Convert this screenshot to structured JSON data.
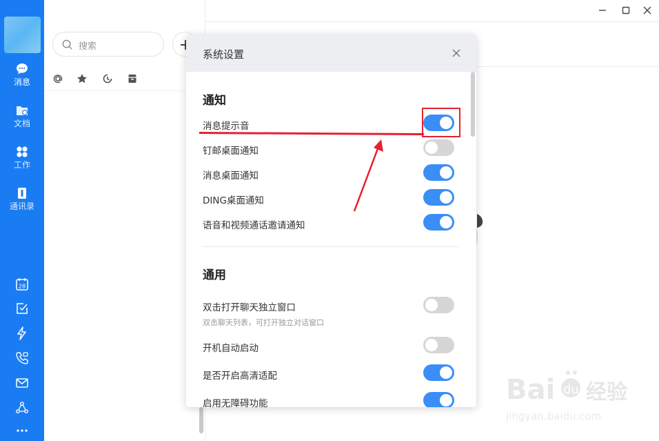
{
  "sidebar": {
    "nav": [
      {
        "label": "消息",
        "icon": "chat-bubble-icon",
        "active": true
      },
      {
        "label": "文档",
        "icon": "folder-icon",
        "active": false
      },
      {
        "label": "工作",
        "icon": "grid-icon",
        "active": false
      },
      {
        "label": "通讯录",
        "icon": "contacts-icon",
        "active": false
      }
    ],
    "tools": [
      "calendar-icon",
      "todo-check-icon",
      "lightning-icon",
      "phone-icon",
      "mail-icon",
      "network-icon",
      "more-icon"
    ],
    "calendar_day": "28",
    "accent": "#1a7cf3"
  },
  "chat_list": {
    "search_placeholder": "搜索",
    "filters": [
      "at-icon",
      "star-icon",
      "clock-icon",
      "archive-icon"
    ]
  },
  "dialog": {
    "title": "系统设置",
    "sections": [
      {
        "title": "通知",
        "rows": [
          {
            "label": "消息提示音",
            "on": true
          },
          {
            "label": "钉邮桌面通知",
            "on": false
          },
          {
            "label": "消息桌面通知",
            "on": true
          },
          {
            "label": "DING桌面通知",
            "on": true
          },
          {
            "label": "语音和视频通话邀请通知",
            "on": true
          }
        ]
      },
      {
        "title": "通用",
        "rows": [
          {
            "label": "双击打开聊天独立窗口",
            "sublabel": "双击聊天列表，可打开独立对话窗口",
            "on": false
          },
          {
            "label": "开机自动启动",
            "on": false
          },
          {
            "label": "是否开启高清适配",
            "on": true
          },
          {
            "label": "启用无障碍功能",
            "on": true
          }
        ]
      }
    ],
    "toggle_on_color": "#3a8ef6",
    "toggle_off_color": "#d6d6d6"
  },
  "annotation_color": "#e6202f",
  "watermark": {
    "brand": "Bai du 经验",
    "url": "jingyan.baidu.com"
  }
}
